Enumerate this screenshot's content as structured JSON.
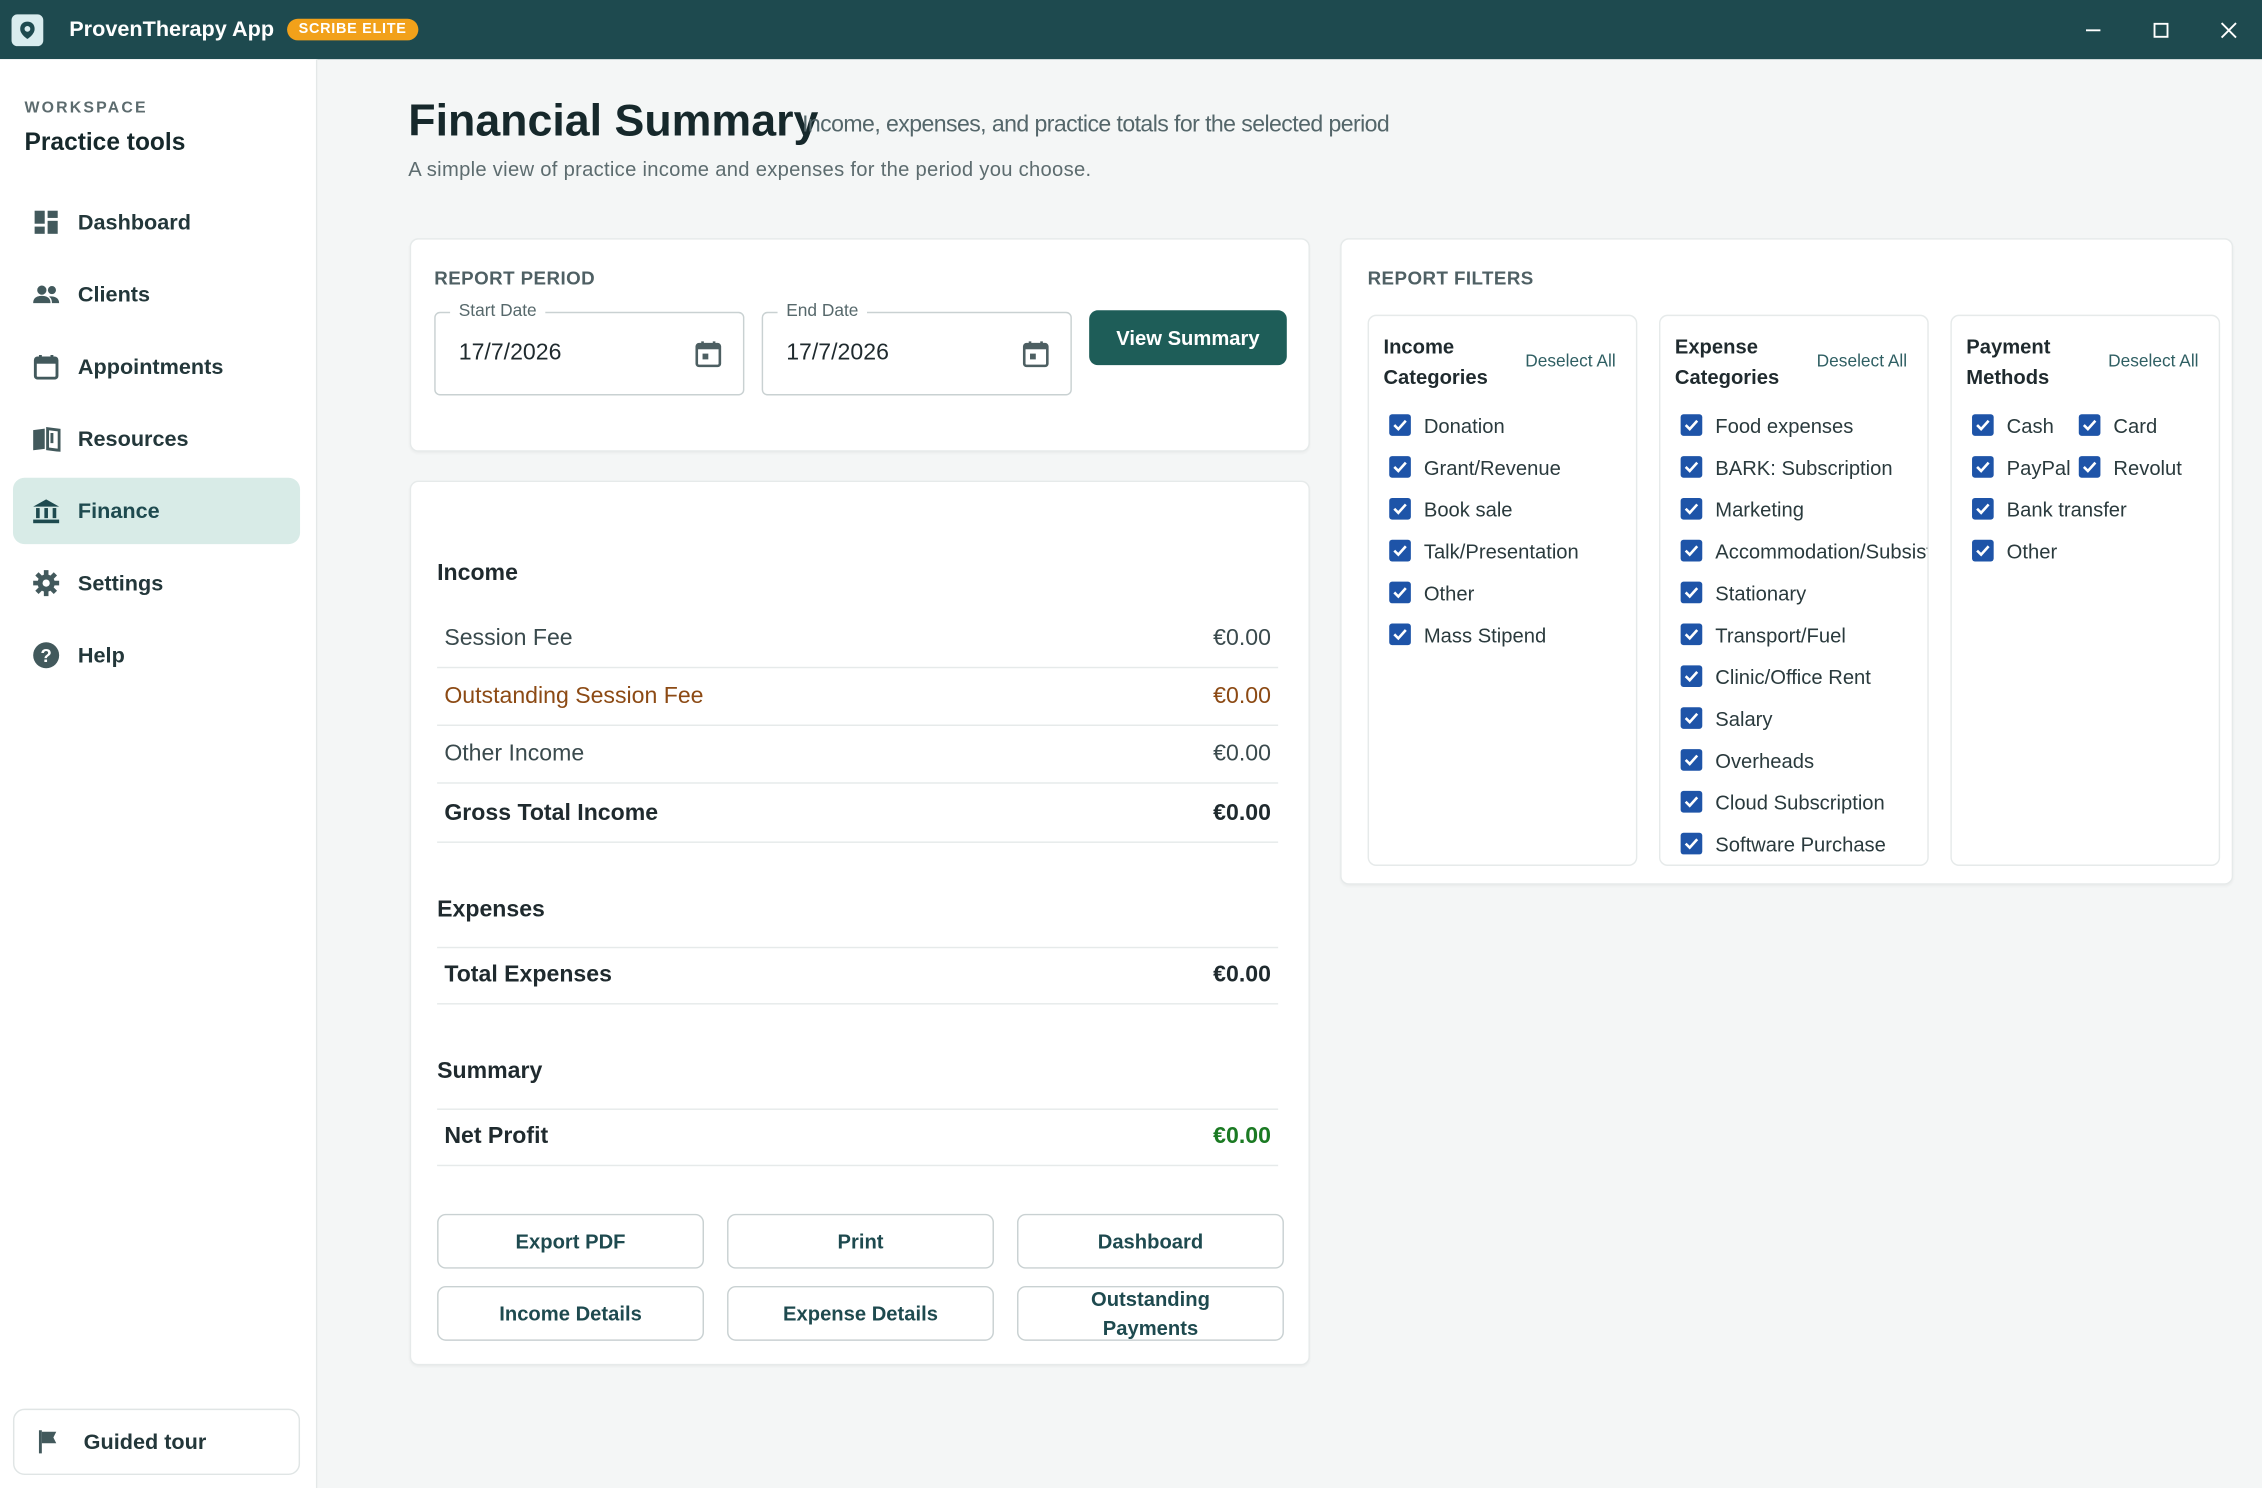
{
  "app": {
    "title": "ProvenTherapy App",
    "tier_badge": "SCRIBE ELITE"
  },
  "sidebar": {
    "kicker": "WORKSPACE",
    "title": "Practice tools",
    "items": [
      {
        "label": "Dashboard",
        "icon": "dashboard-icon"
      },
      {
        "label": "Clients",
        "icon": "people-icon"
      },
      {
        "label": "Appointments",
        "icon": "calendar-icon"
      },
      {
        "label": "Resources",
        "icon": "book-icon"
      },
      {
        "label": "Finance",
        "icon": "bank-icon",
        "active": true
      },
      {
        "label": "Settings",
        "icon": "gear-icon"
      },
      {
        "label": "Help",
        "icon": "help-icon"
      }
    ],
    "guided_tour": "Guided tour"
  },
  "page": {
    "title": "Financial Summary",
    "subtitle": "Income, expenses, and practice totals for the selected period",
    "description": "A simple view of practice income and expenses for the period you choose."
  },
  "period": {
    "kicker": "REPORT PERIOD",
    "start_label": "Start Date",
    "start_value": "17/7/2026",
    "end_label": "End Date",
    "end_value": "17/7/2026",
    "view_button": "View Summary"
  },
  "summary": {
    "income_title": "Income",
    "income_rows": [
      {
        "label": "Session Fee",
        "amount": "€0.00"
      },
      {
        "label": "Outstanding Session Fee",
        "amount": "€0.00"
      },
      {
        "label": "Other Income",
        "amount": "€0.00"
      },
      {
        "label": "Gross Total Income",
        "amount": "€0.00"
      }
    ],
    "expenses_title": "Expenses",
    "total_expenses_label": "Total Expenses",
    "total_expenses_amount": "€0.00",
    "summary_title": "Summary",
    "net_profit_label": "Net Profit",
    "net_profit_amount": "€0.00",
    "actions": {
      "export_pdf": "Export PDF",
      "print": "Print",
      "dashboard": "Dashboard",
      "income_details": "Income Details",
      "expense_details": "Expense Details",
      "outstanding_payments": "Outstanding Payments"
    }
  },
  "filters": {
    "kicker": "REPORT FILTERS",
    "deselect_label": "Deselect All",
    "income": {
      "title": "Income Categories",
      "items": [
        "Donation",
        "Grant/Revenue",
        "Book sale",
        "Talk/Presentation",
        "Other",
        "Mass Stipend"
      ]
    },
    "expense": {
      "title": "Expense Categories",
      "items": [
        "Food expenses",
        "BARK: Subscription",
        "Marketing",
        "Accommodation/Subsistence",
        "Stationary",
        "Transport/Fuel",
        "Clinic/Office Rent",
        "Salary",
        "Overheads",
        "Cloud Subscription",
        "Software Purchase"
      ]
    },
    "payment": {
      "title": "Payment Methods",
      "items": [
        "Cash",
        "Card",
        "PayPal",
        "Revolut",
        "Bank transfer",
        "Other"
      ]
    }
  },
  "colors": {
    "titlebar": "#1e4a4f",
    "accent": "#1e5d58",
    "badge": "#f2a11a",
    "warn": "#8c4a14",
    "profit": "#1b7a23",
    "checkbox": "#1e54a8"
  }
}
